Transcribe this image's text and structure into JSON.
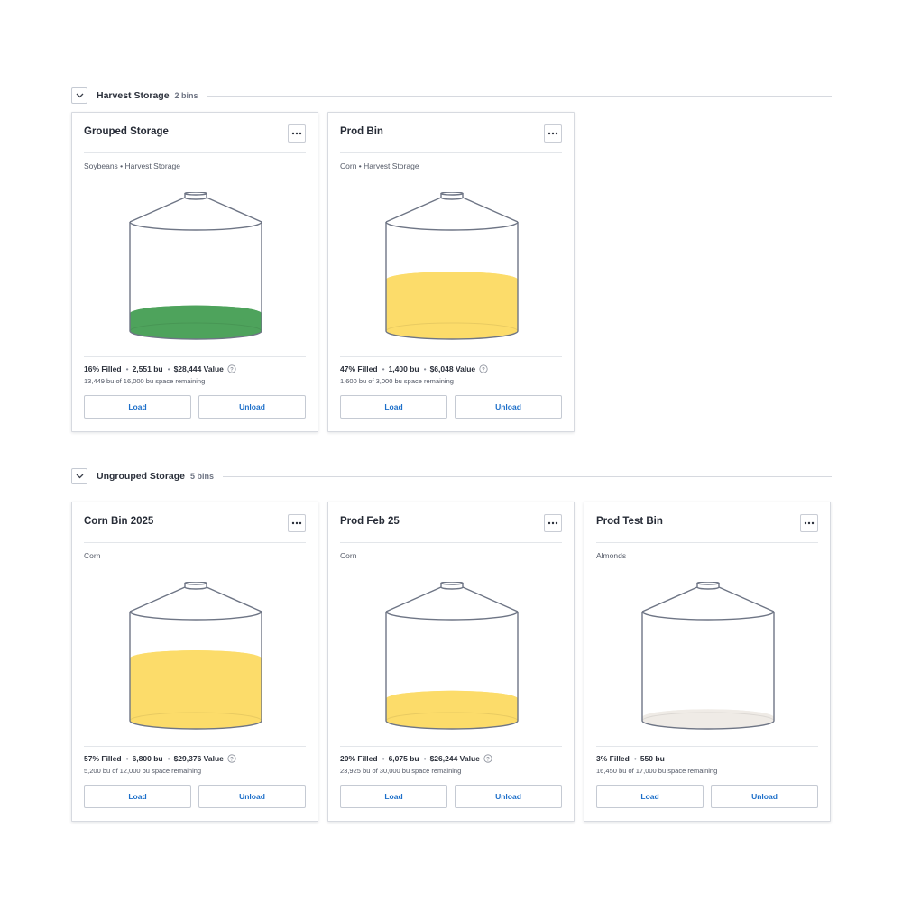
{
  "colors": {
    "soybeans": "#4ea35c",
    "corn": "#fcdc6a",
    "almonds": "#efebe6",
    "accent": "#1d6fc9"
  },
  "groups": [
    {
      "title": "Harvest Storage",
      "count": "2 bins",
      "bins": [
        {
          "title": "Grouped Storage",
          "subtitle": "Soybeans • Harvest Storage",
          "fill_percent": 16,
          "fill_color": "#4ea35c",
          "filled": "16% Filled",
          "bushels": "2,551 bu",
          "value": "$28,444 Value",
          "remaining": "13,449 bu of 16,000 bu space remaining",
          "load": "Load",
          "unload": "Unload"
        },
        {
          "title": "Prod Bin",
          "subtitle": "Corn • Harvest Storage",
          "fill_percent": 47,
          "fill_color": "#fcdc6a",
          "filled": "47% Filled",
          "bushels": "1,400 bu",
          "value": "$6,048 Value",
          "remaining": "1,600 bu of 3,000 bu space remaining",
          "load": "Load",
          "unload": "Unload"
        }
      ]
    },
    {
      "title": "Ungrouped Storage",
      "count": "5 bins",
      "bins": [
        {
          "title": "Corn Bin 2025",
          "subtitle": "Corn",
          "fill_percent": 57,
          "fill_color": "#fcdc6a",
          "filled": "57% Filled",
          "bushels": "6,800 bu",
          "value": "$29,376 Value",
          "remaining": "5,200 bu of 12,000 bu space remaining",
          "load": "Load",
          "unload": "Unload"
        },
        {
          "title": "Prod Feb 25",
          "subtitle": "Corn",
          "fill_percent": 20,
          "fill_color": "#fcdc6a",
          "filled": "20% Filled",
          "bushels": "6,075 bu",
          "value": "$26,244 Value",
          "remaining": "23,925 bu of 30,000 bu space remaining",
          "load": "Load",
          "unload": "Unload"
        },
        {
          "title": "Prod Test Bin",
          "subtitle": "Almonds",
          "fill_percent": 3,
          "fill_color": "#efebe6",
          "filled": "3% Filled",
          "bushels": "550 bu",
          "value": "",
          "remaining": "16,450 bu of 17,000 bu space remaining",
          "load": "Load",
          "unload": "Unload"
        }
      ]
    }
  ]
}
